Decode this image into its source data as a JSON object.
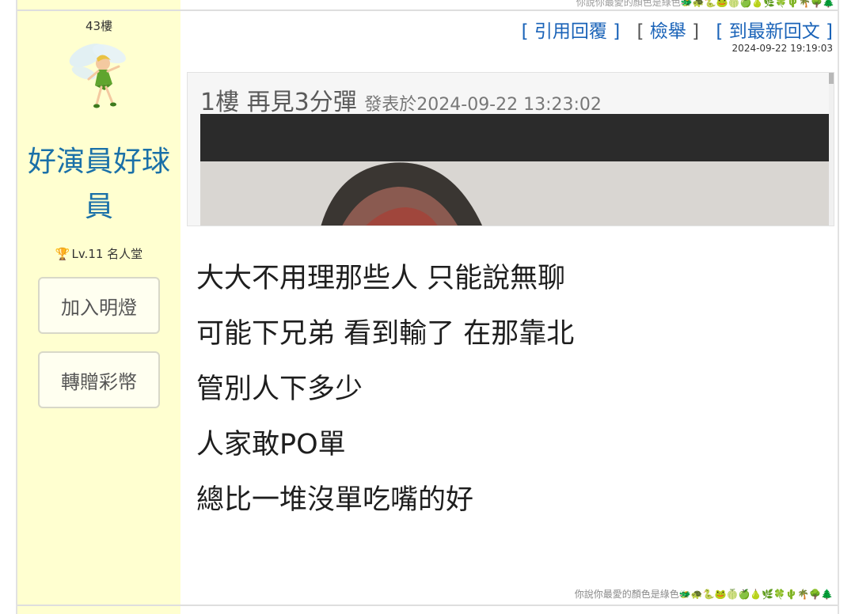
{
  "top_signature": "你說你最愛的顏色是綠色🐲🐢🐍🐸🍈🍏🍐🌿🍀🌵🌴🌳🌲",
  "post": {
    "floor": "43樓",
    "author": {
      "username": "好演員好球員",
      "medal": "🏆",
      "level": "Lv.11 名人堂",
      "avatar_icon": "tinkerbell-fairy-icon"
    },
    "buttons": {
      "join": "加入明燈",
      "gift": "轉贈彩幣"
    },
    "actions": {
      "quote_reply": "引用回覆",
      "report": "檢舉",
      "latest": "到最新回文"
    },
    "timestamp": "2024-09-22 19:19:03",
    "quote": {
      "header": "1樓 再見3分彈",
      "meta": "發表於2024-09-22 13:23:02"
    },
    "body_lines": [
      "大大不用理那些人 只能說無聊",
      "可能下兄弟 看到輸了 在那靠北",
      "管別人下多少",
      "人家敢PO單",
      "總比一堆沒單吃嘴的好"
    ],
    "signature": "你說你最愛的顏色是綠色🐲🐢🐍🐸🍈🍏🍐🌿🍀🌵🌴🌳🌲"
  },
  "colors": {
    "user_panel_bg": "#ffffd0",
    "username": "#1a70a8",
    "action_link": "#1a63b8"
  }
}
